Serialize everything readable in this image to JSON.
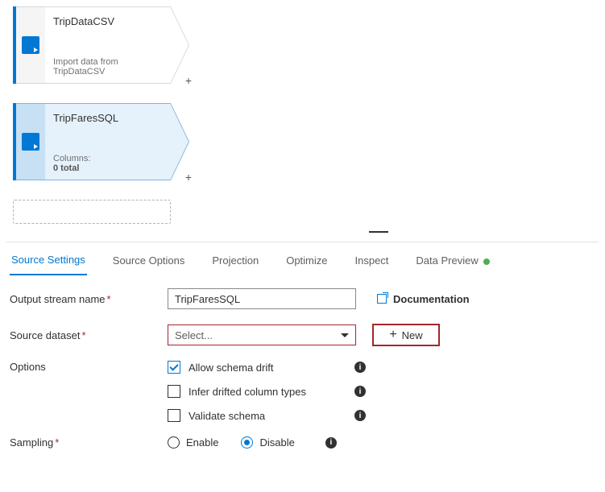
{
  "nodes": {
    "tripdata": {
      "title": "TripDataCSV",
      "subtitle": "Import data from TripDataCSV"
    },
    "tripfares": {
      "title": "TripFaresSQL",
      "columns_label": "Columns:",
      "columns_count": "0 total"
    }
  },
  "tabs": {
    "source_settings": "Source Settings",
    "source_options": "Source Options",
    "projection": "Projection",
    "optimize": "Optimize",
    "inspect": "Inspect",
    "data_preview": "Data Preview"
  },
  "form": {
    "output_stream_label": "Output stream name",
    "output_stream_value": "TripFaresSQL",
    "documentation": "Documentation",
    "source_dataset_label": "Source dataset",
    "source_dataset_placeholder": "Select...",
    "new_button": "New",
    "options_label": "Options",
    "options": {
      "allow_schema_drift": "Allow schema drift",
      "infer_drifted": "Infer drifted column types",
      "validate_schema": "Validate schema"
    },
    "sampling_label": "Sampling",
    "sampling_enable": "Enable",
    "sampling_disable": "Disable"
  }
}
